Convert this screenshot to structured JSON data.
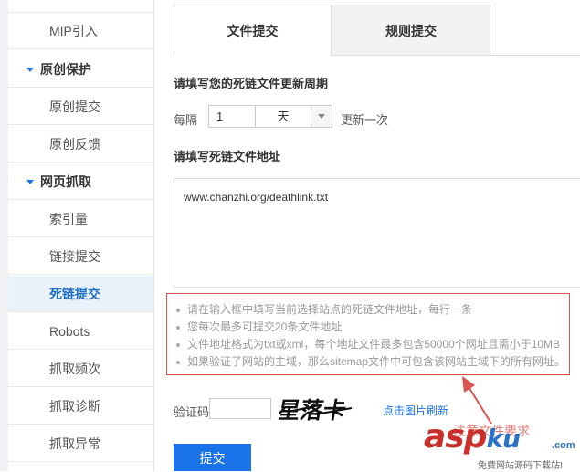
{
  "sidebar": {
    "items": [
      {
        "label": "MIP引入",
        "type": "item"
      },
      {
        "label": "原创保护",
        "type": "group"
      },
      {
        "label": "原创提交",
        "type": "item"
      },
      {
        "label": "原创反馈",
        "type": "item"
      },
      {
        "label": "网页抓取",
        "type": "group"
      },
      {
        "label": "索引量",
        "type": "item"
      },
      {
        "label": "链接提交",
        "type": "item"
      },
      {
        "label": "死链提交",
        "type": "item",
        "active": true
      },
      {
        "label": "Robots",
        "type": "item"
      },
      {
        "label": "抓取频次",
        "type": "item"
      },
      {
        "label": "抓取诊断",
        "type": "item"
      },
      {
        "label": "抓取异常",
        "type": "item"
      }
    ]
  },
  "tabs": [
    {
      "label": "文件提交",
      "active": true
    },
    {
      "label": "规则提交",
      "active": false
    }
  ],
  "form": {
    "period_heading": "请填写您的死链文件更新周期",
    "every_label": "每隔",
    "interval_value": "1",
    "unit_selected": "天",
    "update_once": "更新一次",
    "url_heading": "请填写死链文件地址",
    "url_value": "www.chanzhi.org/deathlink.txt",
    "tips": [
      "请在输入框中填写当前选择站点的死链文件地址，每行一条",
      "您每次最多可提交20条文件地址",
      "文件地址格式为txt或xml，每个地址文件最多包含50000个网址且需小于10MB",
      "如果验证了网站的主域，那么sitemap文件中可包含该网站主域下的所有网址。"
    ],
    "captcha_label": "验证码",
    "captcha_text": "星落卡",
    "refresh_label": "点击图片刷新",
    "submit_label": "提交"
  },
  "annotation": {
    "text": "注意文件要求",
    "color": "#d9534f"
  },
  "watermark": {
    "main": "asp",
    "ku": "ku",
    "com": ".com",
    "sub": "免费网站源码下载站!"
  },
  "colors": {
    "accent": "#1a73e8",
    "tip_border": "#d9534f"
  }
}
